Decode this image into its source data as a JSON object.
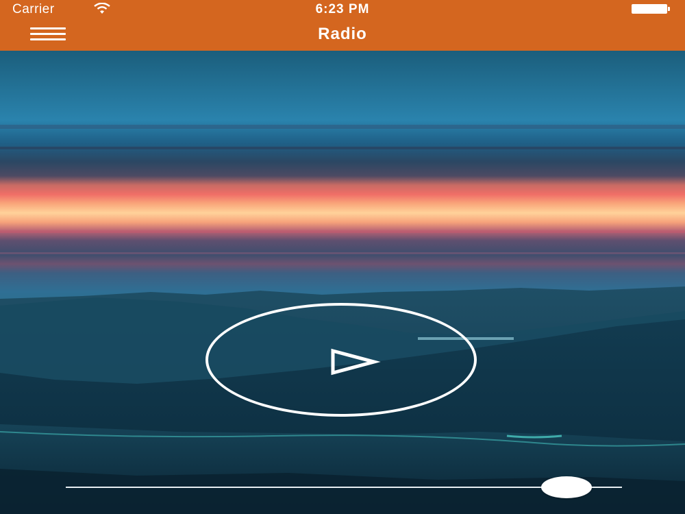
{
  "status_bar": {
    "carrier": "Carrier",
    "time": "6:23 PM",
    "wifi_icon": "wifi-icon",
    "battery_icon": "battery-full-icon"
  },
  "nav": {
    "title": "Radio",
    "menu_icon": "hamburger-menu-icon"
  },
  "player": {
    "play_icon": "play-icon",
    "volume_level": 0.94
  },
  "colors": {
    "header": "#d4661f",
    "foreground": "#ffffff"
  }
}
